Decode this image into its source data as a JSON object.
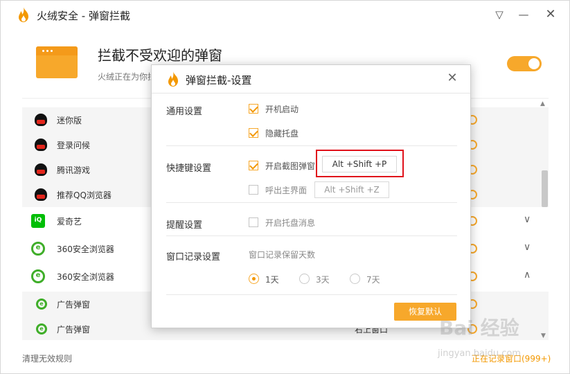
{
  "window": {
    "title": "火绒安全 - 弹窗拦截"
  },
  "header": {
    "title": "拦截不受欢迎的弹窗",
    "subtitle": "火绒正在为你拦",
    "toggle_on": true
  },
  "list": {
    "rows": [
      {
        "name": "迷你版",
        "icon": "qq-penguin-icon",
        "sub": true
      },
      {
        "name": "登录问候",
        "icon": "qq-penguin-icon",
        "sub": true
      },
      {
        "name": "腾讯游戏",
        "icon": "qq-penguin-icon",
        "sub": true
      },
      {
        "name": "推荐QQ浏览器",
        "icon": "qq-penguin-icon",
        "sub": true
      },
      {
        "name": "爱奇艺",
        "icon": "iqiyi-icon",
        "sub": false,
        "chevron": "down"
      },
      {
        "name": "360安全浏览器",
        "icon": "360-browser-icon",
        "sub": false,
        "chevron": "down"
      },
      {
        "name": "360安全浏览器",
        "icon": "360-browser-icon",
        "sub": false,
        "chevron": "up"
      },
      {
        "name": "广告弹窗",
        "icon": "360-browser-icon",
        "sub": true
      },
      {
        "name": "广告弹窗",
        "icon": "360-browser-icon",
        "sub": true,
        "tail": "右上窗口"
      }
    ]
  },
  "footer": {
    "left": "清理无效规则",
    "right": "正在记录窗口(999+)"
  },
  "dialog": {
    "title": "弹窗拦截-设置",
    "general_label": "通用设置",
    "autostart_label": "开机启动",
    "autostart_checked": true,
    "hide_tray_label": "隐藏托盘",
    "hide_tray_checked": true,
    "hotkey_label": "快捷键设置",
    "screenshot_label": "开启截图弹窗",
    "screenshot_checked": true,
    "screenshot_hotkey": "Alt +Shift +P",
    "main_ui_label": "呼出主界面",
    "main_ui_checked": false,
    "main_ui_hotkey": "Alt +Shift +Z",
    "reminder_label": "提醒设置",
    "tray_msg_label": "开启托盘消息",
    "tray_msg_checked": false,
    "record_label": "窗口记录设置",
    "retention_label": "窗口记录保留天数",
    "retention_options": [
      "1天",
      "3天",
      "7天"
    ],
    "retention_selected": "1天",
    "restore_button": "恢复默认"
  },
  "watermark": {
    "main": "Bai 经验",
    "sub": "jingyan.baidu.com"
  },
  "colors": {
    "accent": "#f7a82b",
    "highlight": "#e0101a"
  }
}
